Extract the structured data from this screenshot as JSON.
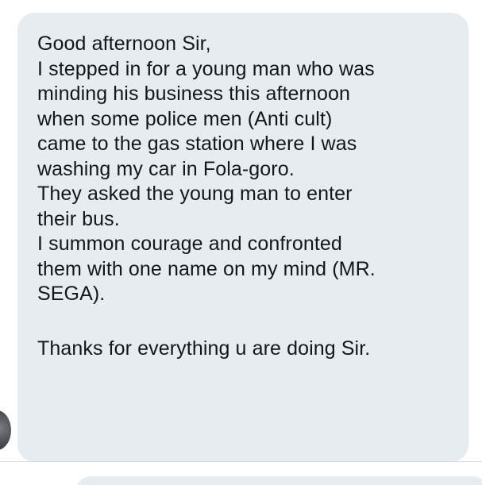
{
  "conversation": {
    "message": {
      "lines": [
        "Good afternoon Sir,",
        "I stepped in for a young man who was",
        "minding his business this afternoon",
        "when some police men (Anti cult)",
        "came to the gas station where I was",
        "washing my car in Fola-goro.",
        "They asked the young man to enter",
        "their bus.",
        "I summon courage and confronted",
        "them with one name on my mind (MR.",
        "SEGA).",
        "",
        "Thanks for everything u are doing Sir."
      ]
    }
  },
  "colors": {
    "bubble_background": "#e7ecf0",
    "text": "#14171a",
    "divider": "#d7dde2"
  },
  "icons": {
    "sender_avatar": "avatar"
  }
}
